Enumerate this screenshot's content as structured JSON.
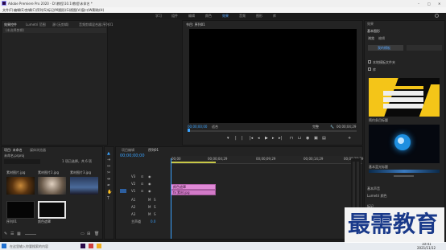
{
  "window": {
    "title": "Adobe Premiere Pro 2020 - D:\\教程\\10.1\\教程\\未命名 *",
    "controls": [
      "–",
      "□",
      "✕"
    ]
  },
  "menu": {
    "items": [
      "文件(F)",
      "编辑(E)",
      "剪辑(C)",
      "序列(S)",
      "标记(M)",
      "图形(G)",
      "视图(V)",
      "窗口(W)",
      "帮助(H)"
    ]
  },
  "workspaces": {
    "tabs": [
      "学习",
      "组件",
      "编辑",
      "颜色",
      "效果",
      "音频",
      "图形",
      "库"
    ],
    "active_index": 4
  },
  "source_panel": {
    "tabs": [
      "效果控件",
      "Lumetri 范围",
      "源:(无剪辑)",
      "音频剪辑混合器:序列01"
    ],
    "no_selection": "(未选择剪辑)"
  },
  "program_panel": {
    "tab": "节目: 序列01",
    "timecode_left": "00;00;00;00",
    "fit": "适合",
    "quality": "完整",
    "timecode_right": "00;00;04;29"
  },
  "project_panel": {
    "tabs": [
      "项目: 未命名",
      "媒体浏览器"
    ],
    "project_name": "未命名.prproj",
    "item_count": "1 项已选择，共 6 项",
    "items": [
      {
        "name": "素材图片.jpg",
        "duration": "4:29"
      },
      {
        "name": "素材图片2.jpg",
        "duration": "4:29"
      },
      {
        "name": "素材图片3.jpg",
        "duration": "4:29"
      },
      {
        "name": "序列01",
        "duration": "4:29"
      },
      {
        "name": "颜色遮罩",
        "duration": "4:29"
      }
    ]
  },
  "timeline": {
    "tabs": [
      "项目编辑",
      "序列01"
    ],
    "timecode": "00;00;00;00",
    "ruler": [
      "00;00",
      "00;00;04;29",
      "00;00;09;29",
      "00;00;14;29",
      "00;00;19;29"
    ],
    "video_tracks": [
      "V3",
      "V2",
      "V1"
    ],
    "audio_tracks": [
      "A1",
      "A2",
      "A3"
    ],
    "master": "主声道",
    "master_value": "0.0",
    "clips": [
      {
        "label": "颜色遮罩",
        "color": "#e08ad6"
      },
      {
        "label": "fx 素材.jpg",
        "color": "#d27ac8"
      }
    ]
  },
  "effects_panel": {
    "header": "效果",
    "section": "基本图形",
    "tabs": [
      "浏览",
      "编辑"
    ],
    "dropdown": "我的模板",
    "checkbox1": "本地模板文件夹",
    "checkbox2": "库",
    "template1": "简约条目标题",
    "template2": "基本蓝光标题",
    "section2": "基本声音",
    "section3": "Lumetri 颜色",
    "section4": "标记"
  },
  "taskbar": {
    "search_placeholder": "在这里输入你要搜索的内容",
    "time": "10:41",
    "date": "2021/11/12"
  },
  "watermark": {
    "text": "最需教育"
  },
  "colors": {
    "accent_blue": "#2d8ceb",
    "clip_pink": "#e08ad6",
    "playhead": "#3aa3ff"
  }
}
